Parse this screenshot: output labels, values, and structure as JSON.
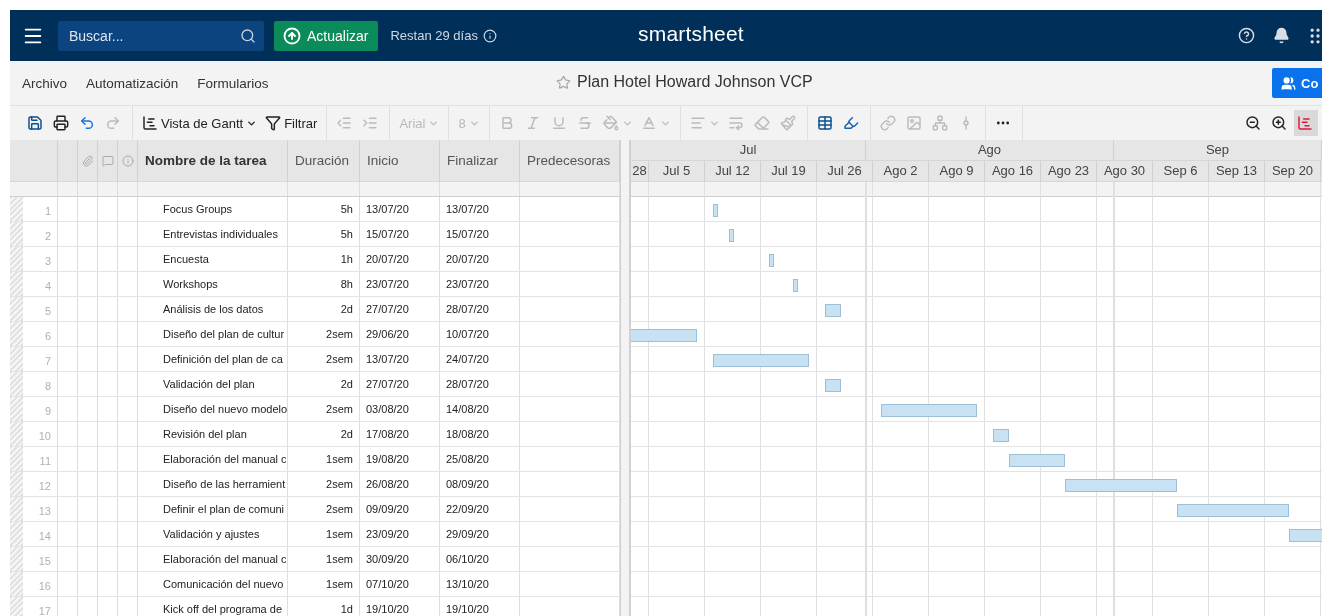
{
  "topbar": {
    "search": {
      "placeholder": "Buscar..."
    },
    "upgrade_button": "Actualizar",
    "trial": "Restan 29 días",
    "logo": "smartsheet"
  },
  "menu": [
    "Archivo",
    "Automatización",
    "Formularios"
  ],
  "sheet_title": "Plan Hotel Howard Johnson VCP",
  "share_button": "Co",
  "toolbar": {
    "groups": [
      [
        {
          "kind": "save",
          "disabled": false
        },
        {
          "kind": "print",
          "disabled": false
        },
        {
          "kind": "undo",
          "disabled": false
        },
        {
          "kind": "redo",
          "disabled": true
        }
      ],
      [
        {
          "kind": "view",
          "label": "Vista de Gantt",
          "disabled": false
        },
        {
          "kind": "filter",
          "label": "Filtrar",
          "disabled": false
        }
      ],
      [
        {
          "kind": "outdent",
          "disabled": true
        },
        {
          "kind": "indent",
          "disabled": true
        }
      ],
      [
        {
          "kind": "font",
          "label": "Arial",
          "disabled": true
        }
      ],
      [
        {
          "kind": "size",
          "label": "8",
          "disabled": true
        }
      ],
      [
        {
          "kind": "bold",
          "disabled": true
        },
        {
          "kind": "italic",
          "disabled": true
        },
        {
          "kind": "underline",
          "disabled": true
        },
        {
          "kind": "strike",
          "disabled": true
        },
        {
          "kind": "fill",
          "disabled": true
        },
        {
          "kind": "textcolor",
          "disabled": true
        }
      ],
      [
        {
          "kind": "align",
          "disabled": true
        },
        {
          "kind": "wrap",
          "disabled": true
        },
        {
          "kind": "eraser",
          "disabled": true
        },
        {
          "kind": "painter",
          "disabled": true
        }
      ],
      [
        {
          "kind": "format",
          "disabled": false
        },
        {
          "kind": "highlight",
          "disabled": false
        }
      ],
      [
        {
          "kind": "link",
          "disabled": true
        },
        {
          "kind": "image",
          "disabled": true
        },
        {
          "kind": "dependency",
          "disabled": true
        },
        {
          "kind": "hierarchy",
          "disabled": true
        }
      ],
      [
        {
          "kind": "more",
          "disabled": false
        }
      ]
    ],
    "right": [
      {
        "kind": "zoomout",
        "selected": false
      },
      {
        "kind": "zoomin",
        "selected": false
      },
      {
        "kind": "gantt",
        "selected": true
      }
    ]
  },
  "columns": [
    "Nombre de la tarea",
    "Duración",
    "Inicio",
    "Finalizar",
    "Predecesoras"
  ],
  "timeline": {
    "months": [
      "Jul",
      "Ago",
      "Sep"
    ],
    "weeks": [
      "28",
      "Jul 5",
      "Jul 12",
      "Jul 19",
      "Jul 26",
      "Ago 2",
      "Ago 9",
      "Ago 16",
      "Ago 23",
      "Ago 30",
      "Sep 6",
      "Sep 13",
      "Sep 20"
    ]
  },
  "rows": [
    {
      "number": "1",
      "task": "Focus Groups",
      "duration": "5h",
      "start": "13/07/20",
      "end": "13/07/20"
    },
    {
      "number": "2",
      "task": "Entrevistas individuales",
      "duration": "5h",
      "start": "15/07/20",
      "end": "15/07/20"
    },
    {
      "number": "3",
      "task": "Encuesta",
      "duration": "1h",
      "start": "20/07/20",
      "end": "20/07/20"
    },
    {
      "number": "4",
      "task": "Workshops",
      "duration": "8h",
      "start": "23/07/20",
      "end": "23/07/20"
    },
    {
      "number": "5",
      "task": "Análisis de los datos",
      "duration": "2d",
      "start": "27/07/20",
      "end": "28/07/20"
    },
    {
      "number": "6",
      "task": "Diseño del plan de cultur",
      "duration": "2sem",
      "start": "29/06/20",
      "end": "10/07/20"
    },
    {
      "number": "7",
      "task": "Definición del plan de ca",
      "duration": "2sem",
      "start": "13/07/20",
      "end": "24/07/20"
    },
    {
      "number": "8",
      "task": "Validación del plan",
      "duration": "2d",
      "start": "27/07/20",
      "end": "28/07/20"
    },
    {
      "number": "9",
      "task": "Diseño del nuevo modelo",
      "duration": "2sem",
      "start": "03/08/20",
      "end": "14/08/20"
    },
    {
      "number": "10",
      "task": "Revisión del plan",
      "duration": "2d",
      "start": "17/08/20",
      "end": "18/08/20"
    },
    {
      "number": "11",
      "task": "Elaboración del manual c",
      "duration": "1sem",
      "start": "19/08/20",
      "end": "25/08/20"
    },
    {
      "number": "12",
      "task": "Diseño de las herramient",
      "duration": "2sem",
      "start": "26/08/20",
      "end": "08/09/20"
    },
    {
      "number": "13",
      "task": "Definir el plan de comuni",
      "duration": "2sem",
      "start": "09/09/20",
      "end": "22/09/20"
    },
    {
      "number": "14",
      "task": "Validación y ajustes",
      "duration": "1sem",
      "start": "23/09/20",
      "end": "29/09/20"
    },
    {
      "number": "15",
      "task": "Elaboración del manual c",
      "duration": "1sem",
      "start": "30/09/20",
      "end": "06/10/20"
    },
    {
      "number": "16",
      "task": "Comunicación del nuevo",
      "duration": "1sem",
      "start": "07/10/20",
      "end": "13/10/20"
    },
    {
      "number": "17",
      "task": "Kick off del programa de",
      "duration": "1d",
      "start": "19/10/20",
      "end": "19/10/20"
    }
  ]
}
